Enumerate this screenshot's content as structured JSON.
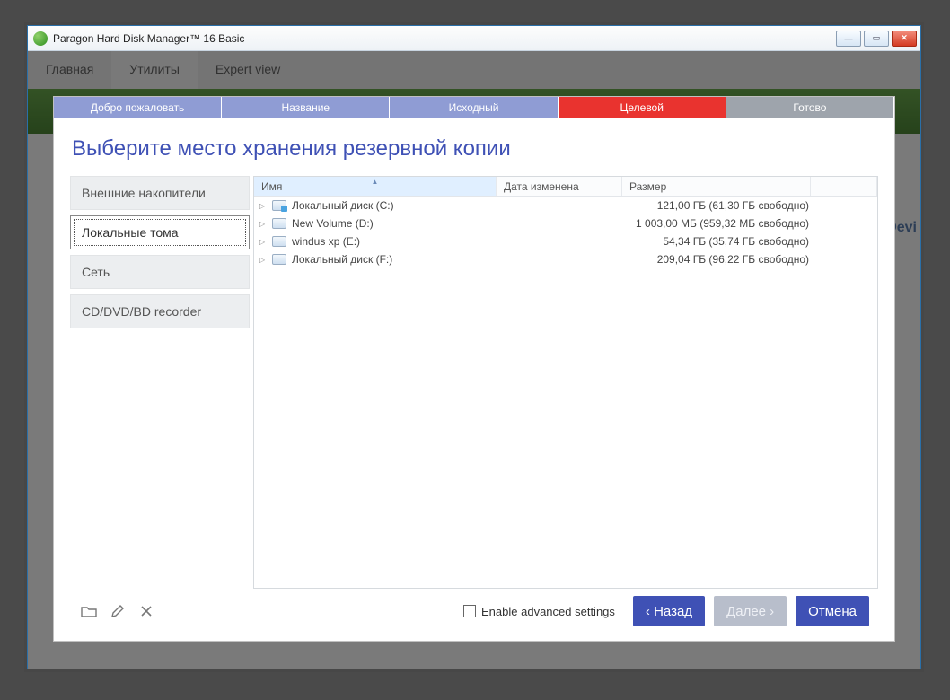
{
  "window": {
    "title": "Paragon Hard Disk Manager™ 16 Basic"
  },
  "bg_tabs": {
    "home": "Главная",
    "utils": "Утилиты",
    "expert": "Expert view"
  },
  "bg_right": {
    "devi": "Devi"
  },
  "steps": [
    {
      "label": "Добро пожаловать",
      "state": "done"
    },
    {
      "label": "Название",
      "state": "done"
    },
    {
      "label": "Исходный",
      "state": "done"
    },
    {
      "label": "Целевой",
      "state": "active"
    },
    {
      "label": "Готово",
      "state": "pending"
    }
  ],
  "dialog": {
    "title": "Выберите место хранения резервной копии"
  },
  "categories": [
    {
      "label": "Внешние накопители",
      "selected": false
    },
    {
      "label": "Локальные тома",
      "selected": true
    },
    {
      "label": "Сеть",
      "selected": false
    },
    {
      "label": "CD/DVD/BD recorder",
      "selected": false
    }
  ],
  "columns": {
    "name": "Имя",
    "date": "Дата изменена",
    "size": "Размер"
  },
  "volumes": [
    {
      "name": "Локальный диск (C:)",
      "size": "121,00 ГБ (61,30 ГБ свободно)",
      "sys": true
    },
    {
      "name": "New Volume (D:)",
      "size": "1 003,00 МБ (959,32 МБ свободно)",
      "sys": false
    },
    {
      "name": "windus xp (E:)",
      "size": "54,34 ГБ (35,74 ГБ свободно)",
      "sys": false
    },
    {
      "name": "Локальный диск (F:)",
      "size": "209,04 ГБ (96,22 ГБ свободно)",
      "sys": false
    }
  ],
  "footer": {
    "advanced": "Enable advanced settings",
    "back": "‹ Назад",
    "next": "Далее ›",
    "cancel": "Отмена"
  }
}
